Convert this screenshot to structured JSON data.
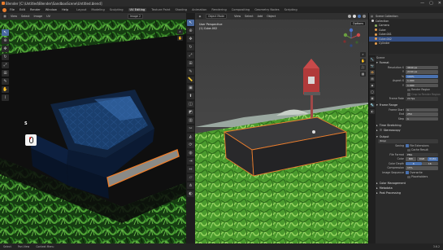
{
  "window": {
    "title": "Blender [C:\\Untitled\\Blender\\SandboxScene\\Untitled.blend]",
    "controls": [
      "—",
      "▢",
      "✕"
    ]
  },
  "menubar": {
    "menus": [
      "File",
      "Edit",
      "Render",
      "Window",
      "Help"
    ],
    "tabs": [
      "Layout",
      "Modeling",
      "Sculpting",
      "UV Editing",
      "Texture Paint",
      "Shading",
      "Animation",
      "Rendering",
      "Compositing",
      "Geometry Nodes",
      "Scripting"
    ],
    "active_tab": "UV Editing"
  },
  "uv_editor": {
    "menu": [
      "View",
      "Select",
      "Image",
      "UV"
    ],
    "image_name": "Image 2",
    "annotation_letter": "S"
  },
  "viewport": {
    "menu": [
      "Object Mode",
      "View",
      "Select",
      "Add",
      "Object"
    ],
    "overlay_title": "User Perspective",
    "overlay_subtitle": "(1) Cube.002",
    "options_label": "Options",
    "colors": {
      "ground": "#4b9b2e",
      "sky": "#b8c8c0",
      "block": "#2e2e30",
      "selection": "#e87d2e"
    }
  },
  "outliner": {
    "header": "Scene Collection",
    "items": [
      {
        "name": "Collection",
        "color": "#cfcfcf",
        "selected": false
      },
      {
        "name": "Camera",
        "color": "#8fb060",
        "selected": false
      },
      {
        "name": "Cube",
        "color": "#e8a050",
        "selected": false
      },
      {
        "name": "Cube.001",
        "color": "#e8a050",
        "selected": false
      },
      {
        "name": "Cube.002",
        "color": "#e8a050",
        "selected": true
      },
      {
        "name": "Cylinder",
        "color": "#e8a050",
        "selected": false
      }
    ]
  },
  "properties": {
    "scene_label": "Scene",
    "format": {
      "header": "Format",
      "rows": [
        {
          "label": "Resolution X",
          "value": "3840 px"
        },
        {
          "label": "Y",
          "value": "2160 px"
        },
        {
          "label": "%",
          "value": "100%",
          "highlight": true
        },
        {
          "label": "Aspect X",
          "value": "1.000"
        },
        {
          "label": "Y",
          "value": "1.000"
        }
      ],
      "render_region": "Render Region",
      "crop": "Crop to Render Region",
      "frame_rate_label": "Frame Rate",
      "frame_rate": "24 fps"
    },
    "frame_range": {
      "header": "Frame Range",
      "rows": [
        {
          "label": "Frame Start",
          "value": "1"
        },
        {
          "label": "End",
          "value": "250"
        },
        {
          "label": "Step",
          "value": "1"
        }
      ]
    },
    "collapsed": [
      "Time Stretching",
      "Stereoscopy"
    ],
    "output": {
      "header": "Output",
      "path": "/tmp\\",
      "saving_label": "Saving",
      "file_extensions": "File Extensions",
      "cache_result": "Cache Result",
      "file_format_label": "File Format",
      "file_format": "PNG",
      "color_label": "Color",
      "color_options": [
        "BW",
        "RGB",
        "RGBA"
      ],
      "color_active": "RGBA",
      "color_depth_label": "Color Depth",
      "color_depth": [
        "8",
        "16"
      ],
      "compression_label": "Compression",
      "compression": "15%",
      "image_sequence_label": "Image Sequence",
      "overwrite": "Overwrite",
      "placeholders": "Placeholders"
    },
    "tail_sections": [
      "Color Management",
      "Metadata",
      "Post Processing"
    ]
  },
  "statusbar": {
    "items": [
      "Select",
      "Pan View",
      "Context Menu"
    ],
    "version": "3.6.2"
  }
}
